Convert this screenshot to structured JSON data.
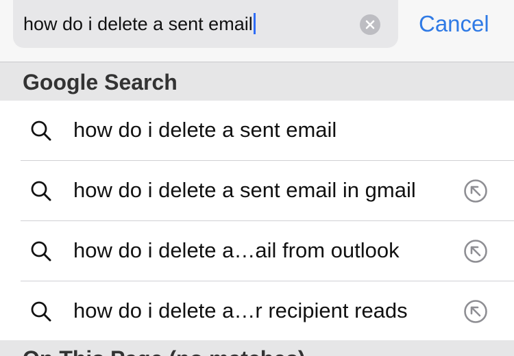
{
  "search": {
    "query": "how do i delete a sent email",
    "cancel_label": "Cancel"
  },
  "sections": {
    "google_search_title": "Google Search",
    "on_this_page_title": "On This Page (no matches)"
  },
  "suggestions": [
    {
      "label": "how do i delete a sent email",
      "icon": "search-icon",
      "has_fill_button": false
    },
    {
      "label": "how do i delete a sent email in gmail",
      "icon": "search-icon",
      "has_fill_button": true
    },
    {
      "label": "how do i delete a…ail from outlook",
      "icon": "search-icon",
      "has_fill_button": true
    },
    {
      "label": "how do i delete a…r recipient reads",
      "icon": "search-icon",
      "has_fill_button": true
    }
  ],
  "colors": {
    "accent": "#2f7ae5",
    "caret": "#2f6df6",
    "section_bg": "#e6e6e7",
    "field_bg": "#e7e7e9"
  }
}
